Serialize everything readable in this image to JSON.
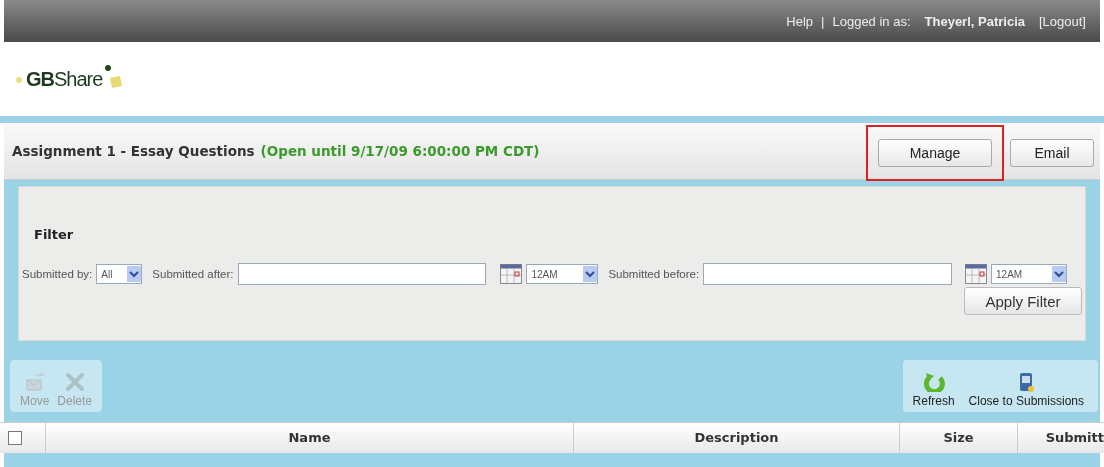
{
  "top_bar": {
    "help": "Help",
    "separator": "|",
    "logged_in_label": "Logged in as:",
    "user": "Theyerl, Patricia",
    "logout": "[Logout]"
  },
  "logo": {
    "text_bold": "GB",
    "text": "Share"
  },
  "assignment": {
    "title": "Assignment 1 - Essay Questions",
    "status": "(Open until 9/17/09 6:00:00 PM CDT)",
    "buttons": [
      {
        "label": "Manage",
        "highlighted": true
      },
      {
        "label": "Email",
        "highlighted": false
      }
    ]
  },
  "filter": {
    "title": "Filter",
    "fields": [
      {
        "kind": "select",
        "label": "Submitted by:",
        "value": "All"
      },
      {
        "kind": "date",
        "label": "Submitted after:",
        "time": "12AM"
      },
      {
        "kind": "date",
        "label": "Submitted before:",
        "time": "12AM"
      }
    ],
    "apply_button": "Apply Filter"
  },
  "toolbar_left": [
    {
      "label": "Move",
      "kind": "move",
      "disabled": true
    },
    {
      "label": "Delete",
      "kind": "delete",
      "disabled": true
    }
  ],
  "toolbar_right": [
    {
      "label": "Refresh",
      "kind": "refresh",
      "disabled": false
    },
    {
      "label": "Close to Submissions",
      "kind": "close",
      "disabled": false
    }
  ],
  "table": {
    "select_all_checked": false,
    "columns": [
      "Name",
      "Description",
      "Size",
      "Submitt"
    ]
  }
}
